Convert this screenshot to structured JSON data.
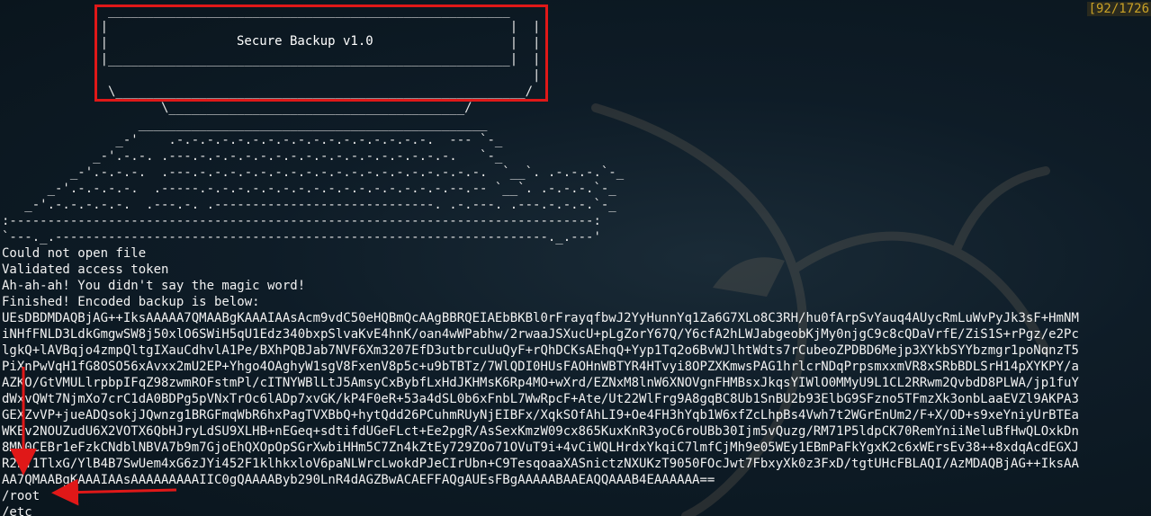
{
  "counter": "[92/1726",
  "banner": {
    "art": [
      "              _____________________________________________________  ",
      "             |                                                     |  |",
      "             |                                                     |  |",
      "             |_____________________________________________________|  |",
      "                                                                      |",
      "              \\______________________________________________________/",
      "                     \\_______________________________________/",
      "                  ______________________________________________",
      "               _-'    .-.-.-.-.-.-.-.-.-.-.-.-.-.-.-.-.-.  --- `-_",
      "            _-'.-.-. .---.-.-.-.-.-.-.-.-.-.-.-.-.-.-.-.-.-.   `-_",
      "         _-'.-.-.-.  .---.-.-.-.-.-.-.-.-.-.-.-.-.-.-.-.-.-.-.-.  `__`. .-.-.-.`-_",
      "      _-'.-.-.-.-.  .-----.-.-.-.-.-.-.-.-.-.-.-.-.-.-.-.-.--.-- `__`. .-.-.-.`-_",
      "   _-'.-.-.-.-.-.  .---.-. .-----------------------------. .-.---. .---.-.-.-.`-_",
      ":-----------------------------------------------------------------------------:",
      "`---._.-----------------------------------------------------------------._.---'"
    ],
    "title": "Secure Backup v1.0"
  },
  "output_lines": [
    "Could not open file",
    "Validated access token",
    "Ah-ah-ah! You didn't say the magic word!",
    "Finished! Encoded backup is below:",
    "UEsDBDMDAQBjAG++IksAAAAA7QMAABgKAAAIAAsAcm9vdC50eHQBmQcAAgBBRQEIAEbBKBl0rFrayqfbwJ2YyHunnYq1Za6G7XLo8C3RH/hu0fArpSvYauq4AUycRmLuWvPyJk3sF+HmNM",
    "iNHfFNLD3LdkGmgwSW8j50xlO6SWiH5qU1Edz340bxpSlvaKvE4hnK/oan4wWPabhw/2rwaaJSXucU+pLgZorY67Q/Y6cfA2hLWJabgeobKjMy0njgC9c8cQDaVrfE/ZiS1S+rPgz/e2Pc",
    "lgkQ+lAVBqjo4zmpQltgIXauCdhvlA1Pe/BXhPQBJab7NVF6Xm3207EfD3utbrcuUuQyF+rQhDCKsAEhqQ+Yyp1Tq2o6BvWJlhtWdts7rCubeoZPDBD6Mejp3XYkbSYYbzmgr1poNqnzT5",
    "PiXnPwVqH1fG8OSO56xAvxx2mU2EP+Yhgo4OAghyW1sgV8FxenV8p5c+u9bTBTz/7WlQDI0HUsFAOHnWBTYR4HTvyi8OPZXKmwsPAG1hrlcrNDqPrpsmxxmVR8xSRbBDLSrH14pXYKPY/a",
    "AZKO/GtVMULlrpbpIFqZ98zwmROFstmPl/cITNYWBlLtJ5AmsyCxBybfLxHdJKHMsK6Rp4MO+wXrd/EZNxM8lnW6XNOVgnFHMBsxJkqsYIWlO0MMyU9L1CL2RRwm2QvbdD8PLWA/jp1fuY",
    "dWxvQWt7NjmXo7crC1dA0BDPg5pVNxTrOc6lADp7xvGK/kP4F0eR+53a4dSL0b6xFnbL7WwRpcF+Ate/Ut22WlFrg9A8gqBC8Ub1SnBU2b93ElbG9SFzno5TFmzXk3onbLaaEVZl9AKPA3",
    "GEXZvVP+jueADQsokjJQwnzg1BRGFmqWbR6hxPagTVXBbQ+hytQdd26PCuhmRUyNjEIBFx/XqkSOfAhLI9+Oe4FH3hYqb1W6xfZcLhpBs4Vwh7t2WGrEnUm2/F+X/OD+s9xeYniyUrBTEa",
    "WKEv2NOUZudU6X2VOTX6QbHJryLdSU9XLHB+nEGeq+sdtifdUGeFLct+Ee2pgR/AsSexKmzW09cx865KuxKnR3yoC6roUBb30Ijm5vQuzg/RM71P5ldpCK70RemYniiNeluBfHwQLOxkDn",
    "8MN0CEBr1eFzkCNdblNBVA7b9m7GjoEhQXOpOpSGrXwbiHHm5C7Zn4kZtEy729ZOo71OVuT9i+4vCiWQLHrdxYkqiC7lmfCjMh9e05WEy1EBmPaFkYgxK2c6xWErsEv38++8xdqAcdEGXJ",
    "R2nT1TlxG/YlB4B7SwUem4xG6zJYi452F1klhkxloV6paNLWrcLwokdPJeCIrUbn+C9TesqoaaXASnictzNXUKzT9050FOcJwt7FbxyXk0z3FxD/tgtUHcFBLAQI/AzMDAQBjAG++IksAA",
    "AA7QMAABgKAAAIAAsAAAAAAAAAIIC0gQAAAAByb290LnR4dAGZBwACAEFFAQgAUEsFBgAAAAABAAEAQQAAAB4EAAAAAA==",
    "/root",
    "/etc"
  ],
  "colors": {
    "background": "#0c1a24",
    "text": "#f2f2f2",
    "annotation": "#e01818",
    "counter": "#c9a227"
  }
}
